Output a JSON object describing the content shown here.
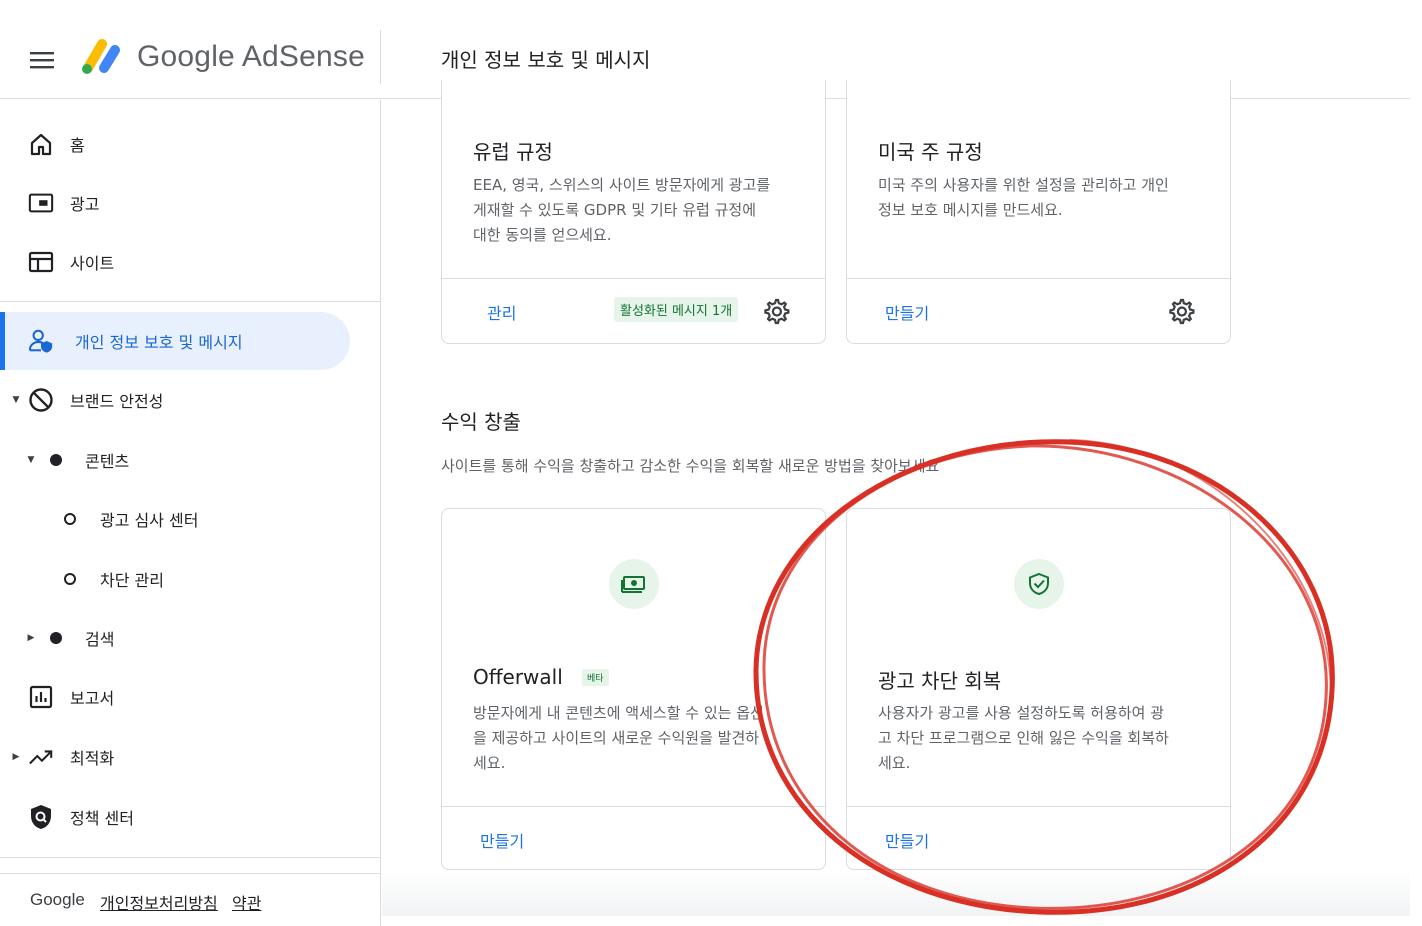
{
  "header": {
    "brand": "Google AdSense",
    "page_title": "개인 정보 보호 및 메시지"
  },
  "sidebar": {
    "items": [
      {
        "label": "홈",
        "icon": "home-icon"
      },
      {
        "label": "광고",
        "icon": "ads-icon"
      },
      {
        "label": "사이트",
        "icon": "sites-icon"
      },
      {
        "label": "개인 정보 보호 및 메시지",
        "icon": "privacy-messaging-icon",
        "active": true
      },
      {
        "label": "브랜드 안전성",
        "icon": "block-icon"
      },
      {
        "label": "콘텐츠"
      },
      {
        "label": "광고 심사 센터"
      },
      {
        "label": "차단 관리"
      },
      {
        "label": "검색"
      },
      {
        "label": "보고서",
        "icon": "reports-icon"
      },
      {
        "label": "최적화",
        "icon": "trending-icon"
      },
      {
        "label": "정책 센터",
        "icon": "policy-shield-icon"
      }
    ],
    "footer": {
      "google": "Google",
      "privacy_link": "개인정보처리방침",
      "terms_link": "약관"
    }
  },
  "main": {
    "regulation_cards": [
      {
        "title": "유럽 규정",
        "description": "EEA, 영국, 스위스의 사이트 방문자에게 광고를 게재할 수 있도록 GDPR 및 기타 유럽 규정에 대한 동의를 얻으세요.",
        "desc_lines": [
          "EEA, 영국, 스위스의 사이트 방문자에게 광고를",
          "게재할 수 있도록 GDPR 및 기타 유럽 규정에",
          "대한 동의를 얻으세요."
        ],
        "action": "관리",
        "badge": "활성화된 메시지 1개"
      },
      {
        "title": "미국 주 규정",
        "description": "미국 주의 사용자를 위한 설정을 관리하고 개인 정보 보호 메시지를 만드세요.",
        "desc_lines": [
          "미국 주의 사용자를 위한 설정을 관리하고 개인",
          "정보 보호 메시지를 만드세요."
        ],
        "action": "만들기"
      }
    ],
    "monetization": {
      "title": "수익 창출",
      "description": "사이트를 통해 수익을 창출하고 감소한 수익을 회복할 새로운 방법을 찾아보세요",
      "cards": [
        {
          "title": "Offerwall",
          "badge": "베타",
          "icon": "money-icon",
          "desc_lines": [
            "방문자에게 내 콘텐츠에 액세스할 수 있는 옵션",
            "을 제공하고 사이트의 새로운 수익원을 발견하",
            "세요."
          ],
          "action": "만들기"
        },
        {
          "title": "광고 차단 회복",
          "icon": "shield-check-icon",
          "desc_lines": [
            "사용자가 광고를 사용 설정하도록 허용하여 광",
            "고 차단 프로그램으로 인해 잃은 수익을 회복하",
            "세요."
          ],
          "action": "만들기"
        }
      ]
    }
  },
  "colors": {
    "accent_blue": "#1a73e8",
    "active_bg": "#e8f0fe",
    "badge_green_bg": "#e6f4ea",
    "badge_green_text": "#137333",
    "annotation_red": "#d93025"
  }
}
